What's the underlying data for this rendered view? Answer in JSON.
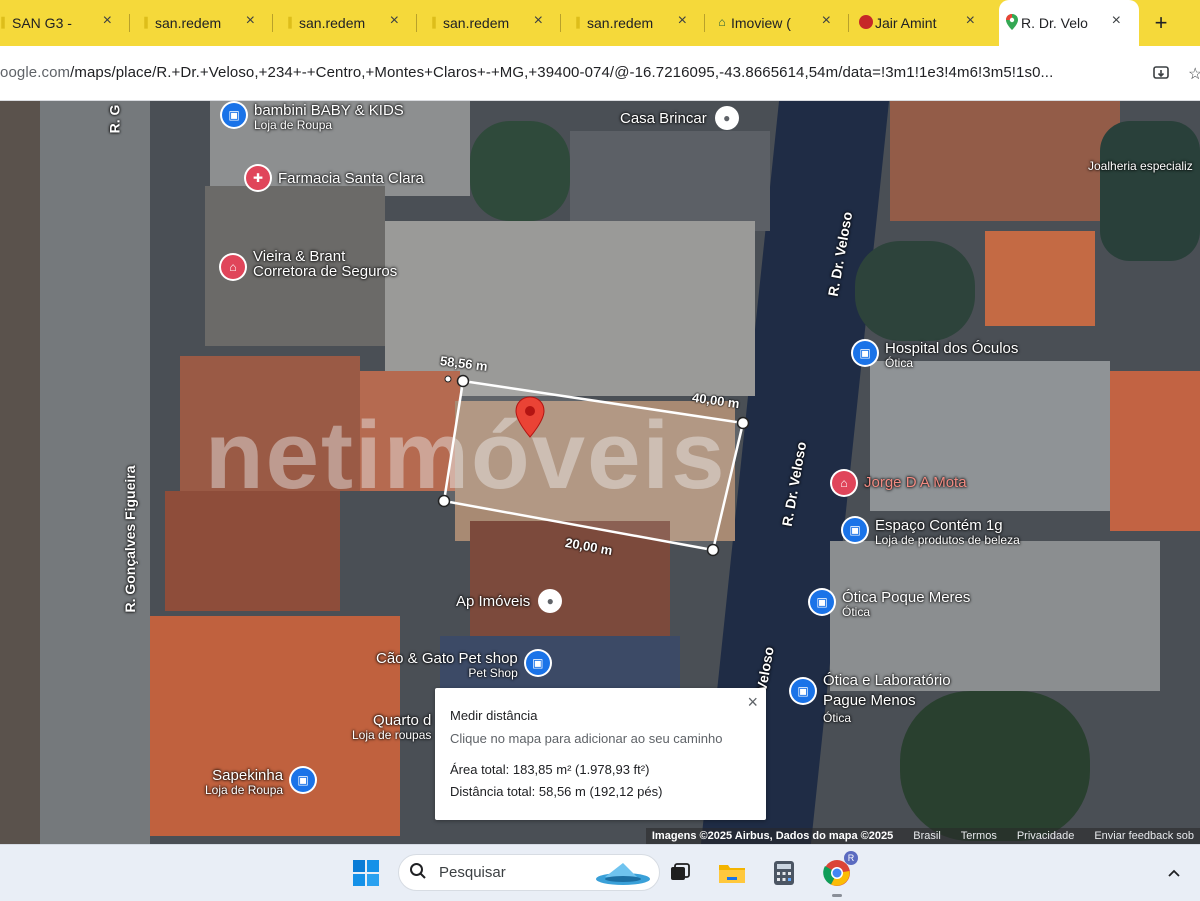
{
  "browser": {
    "tabs": [
      {
        "label": "SAN G3 -",
        "icon": "yellow-brand-icon"
      },
      {
        "label": "san.redem",
        "icon": "yellow-brand-icon"
      },
      {
        "label": "san.redem",
        "icon": "yellow-brand-icon"
      },
      {
        "label": "san.redem",
        "icon": "yellow-brand-icon"
      },
      {
        "label": "san.redem",
        "icon": "yellow-brand-icon"
      },
      {
        "label": "Imoview (",
        "icon": "house-icon"
      },
      {
        "label": "Jair Amint",
        "icon": "red-circle-icon"
      },
      {
        "label": "R. Dr. Velo",
        "icon": "maps-pin-icon",
        "active": true
      }
    ],
    "new_tab_label": "+",
    "close_glyph": "×",
    "url_host": "oogle.com",
    "url_path": "/maps/place/R.+Dr.+Veloso,+234+-+Centro,+Montes+Claros+-+MG,+39400-074/@-16.7216095,-43.8665614,54m/data=!3m1!1e3!4m6!3m5!1s0..."
  },
  "map": {
    "streets": {
      "goncalves": "R. Gonçalves Figueira",
      "goncalves_top": "R. G",
      "veloso_1": "R. Dr. Veloso",
      "veloso_2": "R. Dr. Veloso",
      "veloso_3": "Veloso"
    },
    "pois": [
      {
        "title": "bambini BABY & KIDS",
        "sub": "Loja de Roupa",
        "color": "blue",
        "icon": "shopping-bag-icon"
      },
      {
        "title": "Farmacia Santa Clara",
        "sub": "",
        "color": "red",
        "icon": "pharmacy-icon"
      },
      {
        "title": "Vieira & Brant",
        "sub": "Corretora de Seguros",
        "color": "red",
        "icon": "building-icon"
      },
      {
        "title": "Casa Brincar",
        "sub": "",
        "color": "gray",
        "icon": "place-pin-icon"
      },
      {
        "title": "Joalheria especializ",
        "sub": "",
        "color": "none",
        "icon": ""
      },
      {
        "title": "Hospital dos Óculos",
        "sub": "Ótica",
        "color": "blue",
        "icon": "shopping-bag-icon"
      },
      {
        "title": "Jorge D A Mota",
        "sub": "",
        "color": "red",
        "icon": "building-icon"
      },
      {
        "title": "Espaço Contém 1g",
        "sub": "Loja de produtos de beleza",
        "color": "blue",
        "icon": "shopping-bag-icon"
      },
      {
        "title": "Ótica Poque Meres",
        "sub": "Ótica",
        "color": "blue",
        "icon": "shopping-bag-icon"
      },
      {
        "title": "Ótica e Laboratório",
        "sub": "Pague Menos",
        "color": "blue",
        "icon": "shopping-bag-icon"
      },
      {
        "title": "",
        "sub": "Ótica",
        "color": "none",
        "icon": ""
      },
      {
        "title": "Ap Imóveis",
        "sub": "",
        "color": "gray",
        "icon": "place-pin-icon"
      },
      {
        "title": "Cão & Gato Pet shop",
        "sub": "Pet Shop",
        "color": "blue",
        "icon": "shopping-bag-icon"
      },
      {
        "title": "Quarto d",
        "sub": "Loja de roupas",
        "color": "none",
        "icon": ""
      },
      {
        "title": "Sapekinha",
        "sub": "Loja de Roupa",
        "color": "blue",
        "icon": "shopping-bag-icon"
      }
    ],
    "measurements": {
      "top_left": "58,56 m",
      "top_right": "40,00 m",
      "bottom": "20,00 m"
    },
    "watermark": "netimóveis",
    "footer": {
      "imagery": "Imagens ©2025 Airbus, Dados do mapa ©2025",
      "country": "Brasil",
      "terms": "Termos",
      "privacy": "Privacidade",
      "feedback": "Enviar feedback sob"
    },
    "measure_panel": {
      "title": "Medir distância",
      "hint": "Clique no mapa para adicionar ao seu caminho",
      "area": "Área total: 183,85 m² (1.978,93 ft²)",
      "distance": "Distância total: 58,56 m (192,12 pés)",
      "close": "×"
    }
  },
  "taskbar": {
    "search_placeholder": "Pesquisar",
    "chrome_profile_badge": "R"
  }
}
